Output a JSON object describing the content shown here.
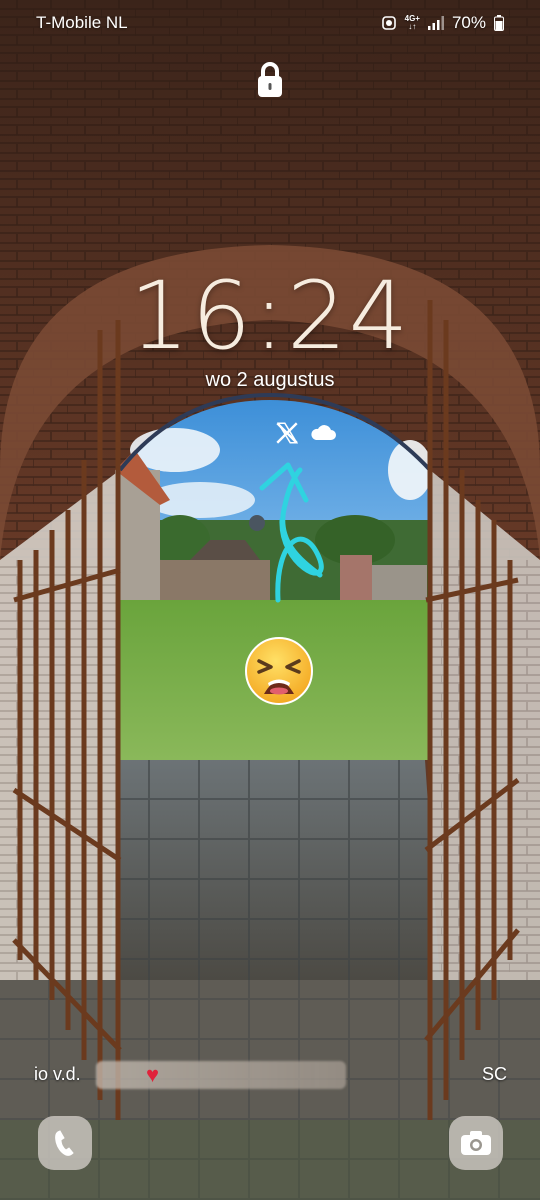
{
  "status_bar": {
    "carrier": "T-Mobile  NL",
    "network": "4G+",
    "battery": "70%"
  },
  "lockscreen": {
    "time": "16:24",
    "date": "wo 2 augustus",
    "notification_icons": [
      "x-icon",
      "cloud-icon"
    ]
  },
  "notification_preview": {
    "sender": "io v.d.",
    "right_text": "SC"
  },
  "shortcuts": {
    "left": "phone-icon",
    "right": "camera-icon"
  },
  "colors": {
    "clock": "#f6ecdf",
    "annotation": "#2fd3e0"
  }
}
